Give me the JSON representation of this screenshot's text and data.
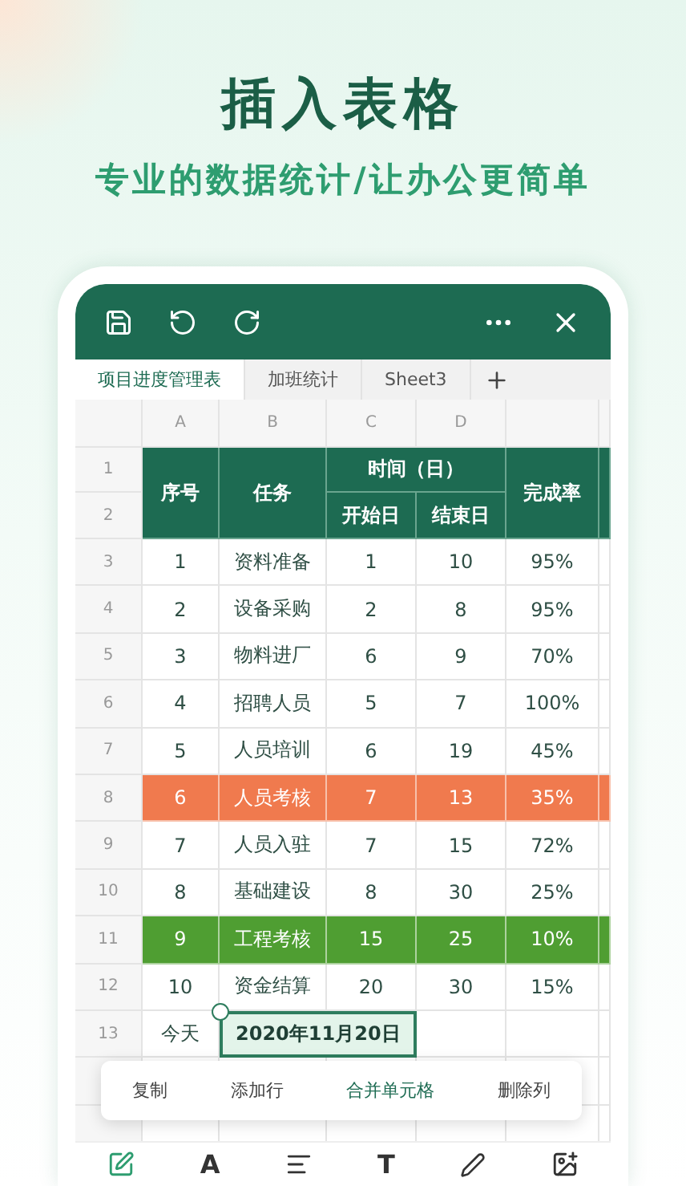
{
  "hero": {
    "title": "插入表格",
    "subtitle": "专业的数据统计/让办公更简单"
  },
  "sheet_tabs": [
    {
      "label": "项目进度管理表",
      "selected": true
    },
    {
      "label": "加班统计",
      "selected": false
    },
    {
      "label": "Sheet3",
      "selected": false
    }
  ],
  "column_headers": [
    "A",
    "B",
    "C",
    "D"
  ],
  "header": {
    "rows": [
      "1",
      "2"
    ],
    "seq": "序号",
    "task": "任务",
    "time": "时间（日）",
    "start": "开始日",
    "end": "结束日",
    "rate": "完成率"
  },
  "rows": [
    {
      "row": "3",
      "cells": [
        "1",
        "资料准备",
        "1",
        "10",
        "95%"
      ]
    },
    {
      "row": "4",
      "cells": [
        "2",
        "设备采购",
        "2",
        "8",
        "95%"
      ]
    },
    {
      "row": "5",
      "cells": [
        "3",
        "物料进厂",
        "6",
        "9",
        "70%"
      ]
    },
    {
      "row": "6",
      "cells": [
        "4",
        "招聘人员",
        "5",
        "7",
        "100%"
      ]
    },
    {
      "row": "7",
      "cells": [
        "5",
        "人员培训",
        "6",
        "19",
        "45%"
      ]
    },
    {
      "row": "8",
      "color": "#f07a4e",
      "cells": [
        "6",
        "人员考核",
        "7",
        "13",
        "35%"
      ]
    },
    {
      "row": "9",
      "cells": [
        "7",
        "人员入驻",
        "7",
        "15",
        "72%"
      ]
    },
    {
      "row": "10",
      "cells": [
        "8",
        "基础建设",
        "8",
        "30",
        "25%"
      ]
    },
    {
      "row": "11",
      "color": "#4f9e32",
      "cells": [
        "9",
        "工程考核",
        "15",
        "25",
        "10%"
      ]
    },
    {
      "row": "12",
      "cells": [
        "10",
        "资金结算",
        "20",
        "30",
        "15%"
      ]
    }
  ],
  "today_row": {
    "row": "13",
    "label": "今天",
    "value": "2020年11月20日"
  },
  "context_menu": [
    {
      "label": "复制",
      "selected": false
    },
    {
      "label": "添加行",
      "selected": false
    },
    {
      "label": "合并单元格",
      "selected": true
    },
    {
      "label": "删除列",
      "selected": false
    }
  ],
  "bottom_toolbar": [
    {
      "kind": "edit",
      "selected": true
    },
    {
      "kind": "letter",
      "label": "A",
      "selected": false
    },
    {
      "kind": "align",
      "selected": false
    },
    {
      "kind": "letter",
      "label": "T",
      "selected": false
    },
    {
      "kind": "pen",
      "selected": false
    },
    {
      "kind": "image",
      "selected": false
    }
  ]
}
